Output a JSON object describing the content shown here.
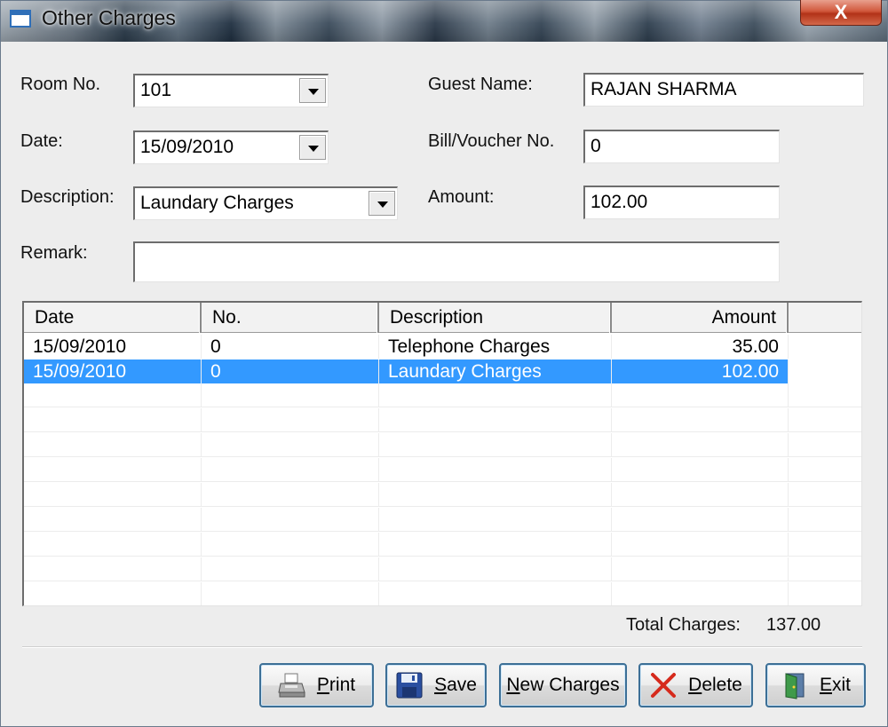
{
  "window": {
    "title": "Other Charges",
    "close_label": "X"
  },
  "form": {
    "room_no": {
      "label": "Room No.",
      "value": "101"
    },
    "date": {
      "label": "Date:",
      "value": "15/09/2010"
    },
    "description": {
      "label": "Description:",
      "value": "Laundary Charges"
    },
    "remark": {
      "label": "Remark:",
      "value": ""
    },
    "guest_name": {
      "label": "Guest Name:",
      "value": "RAJAN SHARMA"
    },
    "bill_voucher": {
      "label": "Bill/Voucher No.",
      "value": "0"
    },
    "amount": {
      "label": "Amount:",
      "value": "102.00"
    }
  },
  "grid": {
    "columns": [
      "Date",
      "No.",
      "Description",
      "Amount"
    ],
    "rows": [
      {
        "date": "15/09/2010",
        "no": "0",
        "description": "Telephone Charges",
        "amount": "35.00",
        "selected": false
      },
      {
        "date": "15/09/2010",
        "no": "0",
        "description": "Laundary Charges",
        "amount": "102.00",
        "selected": true
      }
    ],
    "selection_color": "#3399ff"
  },
  "totals": {
    "label": "Total Charges:",
    "value": "137.00"
  },
  "buttons": {
    "print": {
      "label": "Print",
      "icon": "printer-icon"
    },
    "save": {
      "label": "Save",
      "icon": "floppy-disk-icon"
    },
    "new_charges": {
      "label": "New Charges"
    },
    "delete": {
      "label": "Delete",
      "icon": "red-x-icon"
    },
    "exit": {
      "label": "Exit",
      "icon": "exit-door-icon"
    }
  }
}
